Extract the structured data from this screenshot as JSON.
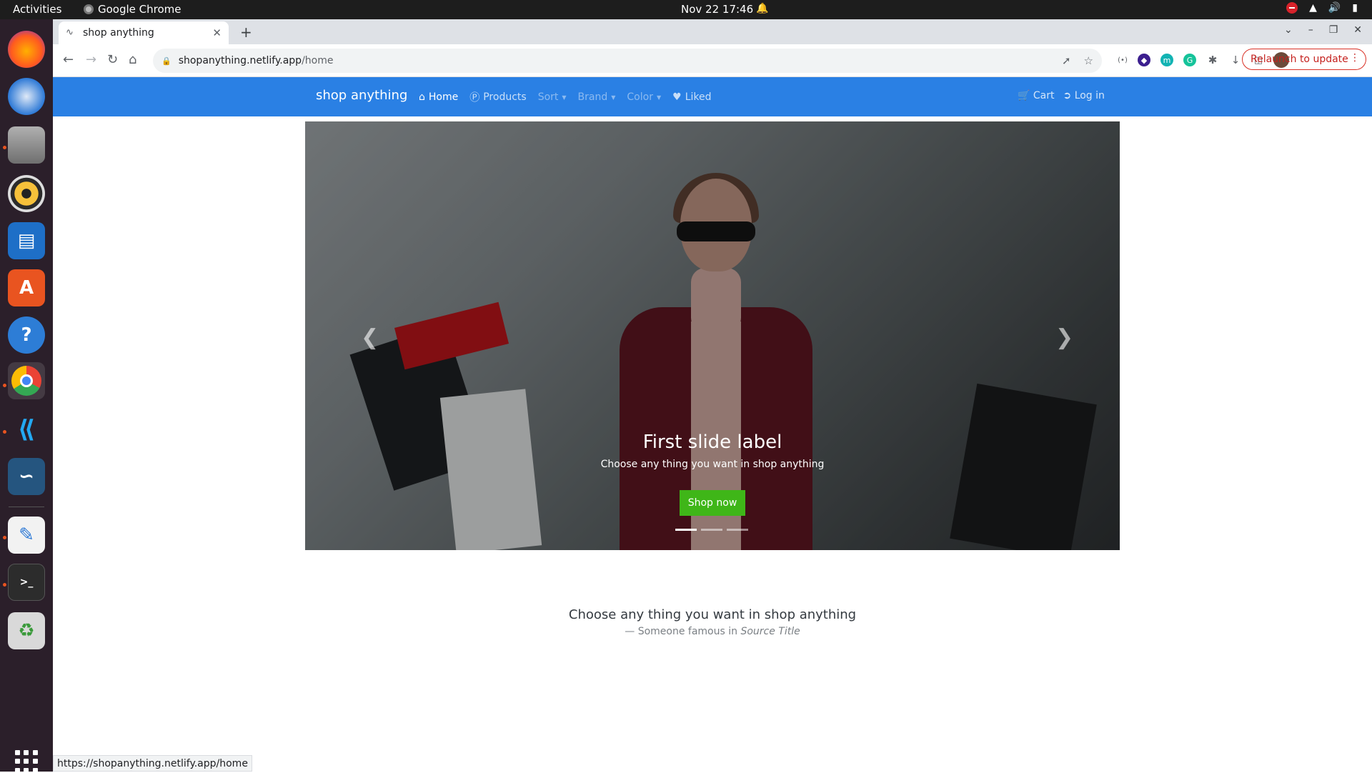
{
  "system": {
    "activities": "Activities",
    "app_name": "Google Chrome",
    "clock": "Nov 22  17:46"
  },
  "dock": {
    "items": [
      "firefox-icon",
      "thunderbird-icon",
      "files-icon",
      "rhythmbox-icon",
      "writer-icon",
      "software-icon",
      "help-icon",
      "chrome-icon",
      "vscode-icon",
      "mysql-workbench-icon",
      "text-editor-icon",
      "terminal-icon",
      "trash-icon"
    ]
  },
  "browser": {
    "tab_title": "shop anything",
    "url_host": "shopanything.netlify.app",
    "url_path": "/home",
    "relaunch_label": "Relaunch to update",
    "status_url": "https://shopanything.netlify.app/home"
  },
  "site": {
    "brand": "shop anything",
    "nav": {
      "home": "Home",
      "products": "Products",
      "sort": "Sort",
      "brand": "Brand",
      "color": "Color",
      "liked": "Liked",
      "cart": "Cart",
      "login": "Log in"
    },
    "carousel": {
      "heading": "First slide label",
      "text": "Choose any thing you want in shop anything",
      "button": "Shop now",
      "slides": 3,
      "active_slide": 1
    },
    "quote": {
      "text": "Choose any thing you want in shop anything",
      "author_prefix": "— Someone famous in ",
      "source": "Source Title"
    }
  },
  "colors": {
    "navbar": "#2a80e4",
    "shop_button": "#3fb618",
    "relaunch": "#c5221f"
  }
}
